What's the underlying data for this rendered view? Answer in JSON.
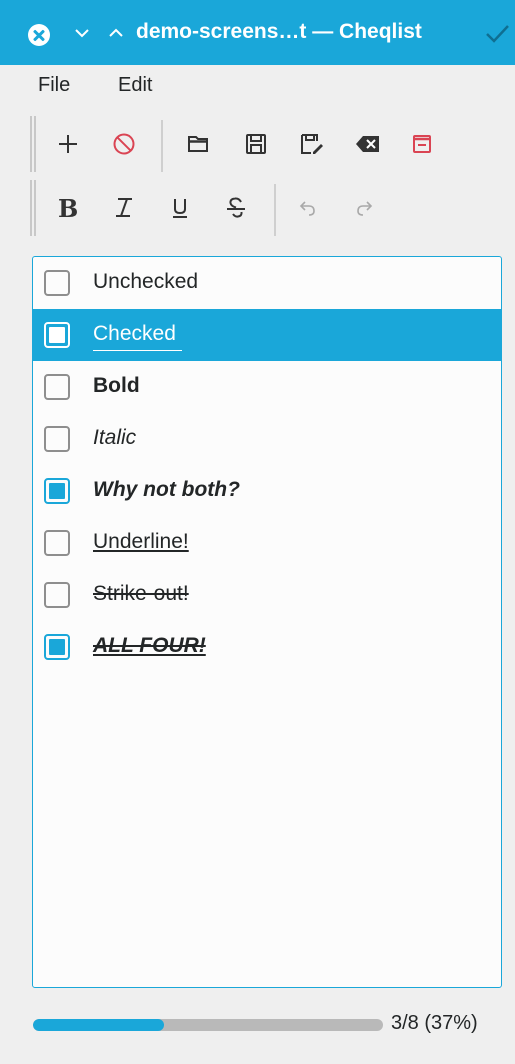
{
  "window": {
    "title": "demo-screens…t — Cheqlist",
    "accent": "#1aa7d9"
  },
  "menu": {
    "items": [
      "File",
      "Edit"
    ]
  },
  "toolbar": {
    "row1": [
      {
        "icon": "plus-icon",
        "name": "add-item"
      },
      {
        "icon": "no-entry-icon",
        "name": "delete-item"
      },
      {
        "icon": "folder-open-icon",
        "name": "open-file"
      },
      {
        "icon": "save-icon",
        "name": "save-file"
      },
      {
        "icon": "save-as-icon",
        "name": "save-as"
      },
      {
        "icon": "backspace-icon",
        "name": "clear"
      },
      {
        "icon": "window-minimize-icon",
        "name": "close-document"
      }
    ],
    "row2": [
      {
        "icon": "bold-icon",
        "name": "bold"
      },
      {
        "icon": "italic-icon",
        "name": "italic"
      },
      {
        "icon": "underline-icon",
        "name": "underline"
      },
      {
        "icon": "strikethrough-icon",
        "name": "strikethrough"
      },
      {
        "icon": "undo-icon",
        "name": "undo"
      },
      {
        "icon": "redo-icon",
        "name": "redo"
      }
    ]
  },
  "items": [
    {
      "label": "Unchecked",
      "checked": false,
      "bold": false,
      "italic": false,
      "underline": false,
      "strike": false,
      "selected": false
    },
    {
      "label": "Checked",
      "checked": true,
      "bold": false,
      "italic": false,
      "underline": false,
      "strike": false,
      "selected": true
    },
    {
      "label": "Bold",
      "checked": false,
      "bold": true,
      "italic": false,
      "underline": false,
      "strike": false,
      "selected": false
    },
    {
      "label": "Italic",
      "checked": false,
      "bold": false,
      "italic": true,
      "underline": false,
      "strike": false,
      "selected": false
    },
    {
      "label": "Why not both?",
      "checked": true,
      "bold": true,
      "italic": true,
      "underline": false,
      "strike": false,
      "selected": false
    },
    {
      "label": "Underline!",
      "checked": false,
      "bold": false,
      "italic": false,
      "underline": true,
      "strike": false,
      "selected": false
    },
    {
      "label": "Strike-out!",
      "checked": false,
      "bold": false,
      "italic": false,
      "underline": false,
      "strike": true,
      "selected": false
    },
    {
      "label": "ALL FOUR!",
      "checked": true,
      "bold": true,
      "italic": true,
      "underline": true,
      "strike": true,
      "selected": false
    }
  ],
  "progress": {
    "text": "3/8 (37%)",
    "fraction": 0.375
  }
}
